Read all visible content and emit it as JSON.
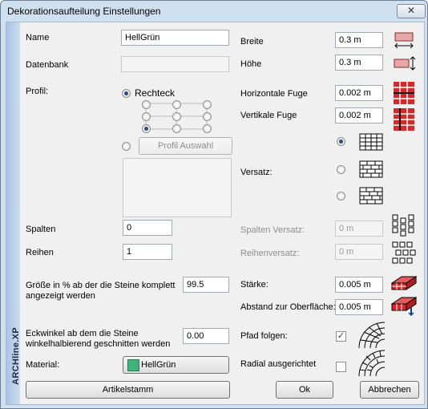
{
  "window": {
    "title": "Dekorationsaufteilung Einstellungen",
    "close_glyph": "✕",
    "side_label": "ARCHline.XP"
  },
  "fields": {
    "name": {
      "label": "Name",
      "value": "HellGrün"
    },
    "datenbank": {
      "label": "Datenbank",
      "value": ""
    },
    "breite": {
      "label": "Breite",
      "value": "0.3 m"
    },
    "hoehe": {
      "label": "Höhe",
      "value": "0.3 m"
    },
    "horizontale_fuge": {
      "label": "Horizontale Fuge",
      "value": "0.002 m"
    },
    "vertikale_fuge": {
      "label": "Vertikale Fuge",
      "value": "0.002 m"
    },
    "spalten": {
      "label": "Spalten",
      "value": "0"
    },
    "reihen": {
      "label": "Reihen",
      "value": "1"
    },
    "spalten_versatz": {
      "label": "Spalten Versatz:",
      "value": "0 m"
    },
    "reihenversatz": {
      "label": "Reihenversatz:",
      "value": "0 m"
    },
    "groesse": {
      "label_line1": "Größe in % ab der die Steine komplett",
      "label_line2": "angezeigt werden",
      "value": "99.5"
    },
    "staerke": {
      "label": "Stärke:",
      "value": "0.005 m"
    },
    "abstand": {
      "label": "Abstand zur Oberfläche:",
      "value": "0.005 m"
    },
    "eckwinkel": {
      "label_line1": "Eckwinkel ab dem die Steine",
      "label_line2": "winkelhalbierend geschnitten werden",
      "value": "0.00"
    },
    "pfad_folgen": {
      "label": "Pfad folgen:",
      "checked": true
    },
    "radial": {
      "label": "Radial ausgerichtet",
      "checked": false
    },
    "material": {
      "label": "Material:",
      "value": "HellGrün",
      "swatch_color": "#3fb37f"
    }
  },
  "profil": {
    "label": "Profil:",
    "rechteck_label": "Rechteck",
    "rechteck_selected": true,
    "auswahl_button": "Profil Auswahl",
    "auswahl_selected": false,
    "anchor_selected_index": 6
  },
  "versatz": {
    "label": "Versatz:",
    "selected_index": 0
  },
  "buttons": {
    "artikelstamm": "Artikelstamm",
    "ok": "Ok",
    "abbrechen": "Abbrechen"
  },
  "colors": {
    "brick": "#d62a2a",
    "check": "#1d3c8a"
  }
}
